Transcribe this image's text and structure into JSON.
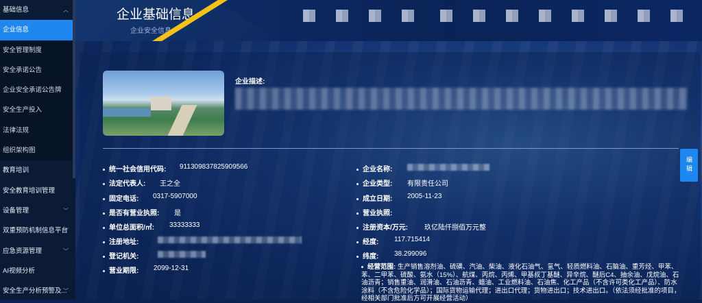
{
  "sidebar": {
    "items": [
      {
        "label": "基础信息",
        "type": "group",
        "chevron": "︿"
      },
      {
        "label": "企业信息",
        "type": "active"
      },
      {
        "label": "安全管理制度",
        "type": "sub"
      },
      {
        "label": "安全承诺公告",
        "type": "sub"
      },
      {
        "label": "企业安全承诺公告牌",
        "type": "sub"
      },
      {
        "label": "安全生产投入",
        "type": "sub"
      },
      {
        "label": "法律法规",
        "type": "sub"
      },
      {
        "label": "组织架构图",
        "type": "sub"
      },
      {
        "label": "教育培训",
        "type": "group"
      },
      {
        "label": "安全教育培训管理",
        "type": "group"
      },
      {
        "label": "设备管理",
        "type": "group",
        "chevron": "﹀"
      },
      {
        "label": "双重预防机制信息平台",
        "type": "group",
        "chevron": "﹀"
      },
      {
        "label": "应急资源管理",
        "type": "group",
        "chevron": "﹀"
      },
      {
        "label": "AI视频分析",
        "type": "group"
      },
      {
        "label": "安全生产分析预警及...",
        "type": "group",
        "chevron": "﹀"
      }
    ]
  },
  "header": {
    "title": "企业基础信息",
    "subtitle": "企业安全信息"
  },
  "company": {
    "desc_label": "企业描述:",
    "edit_label": "编辑",
    "left_fields": [
      {
        "label": "统一社会信用代码:",
        "value": "911309837825909566"
      },
      {
        "label": "法定代表人:",
        "value": "王之全"
      },
      {
        "label": "固定电话:",
        "value": "0317-5907000"
      },
      {
        "label": "是否有营业执照:",
        "value": "是"
      },
      {
        "label": "单位总面积/㎡:",
        "value": "33333333"
      },
      {
        "label": "注册地址:",
        "value": ""
      },
      {
        "label": "登记机关:",
        "value": ""
      },
      {
        "label": "营业期限:",
        "value": "2099-12-31"
      }
    ],
    "right_fields": [
      {
        "label": "企业名称:",
        "value": ""
      },
      {
        "label": "企业类型:",
        "value": "有限责任公司"
      },
      {
        "label": "成立日期:",
        "value": "2005-11-23"
      },
      {
        "label": "营业执照:",
        "value": ""
      },
      {
        "label": "注册资本/万元:",
        "value": "玖亿陆仟捌佰万元整"
      },
      {
        "label": "经度:",
        "value": "117.715414"
      },
      {
        "label": "纬度:",
        "value": "38.299096"
      }
    ],
    "scope_label": "经营范围:",
    "scope_text": "生产销售溶剂油、硫磺、汽油、柴油、液化石油气、氢气、轻质燃料油、石脑油、重芳烃、甲苯、苯、二甲苯、硫酸、氨水（15%）、航煤、丙烷、丙烯、甲基叔丁基醚、异辛烷、醚后C4、抽余油、戊烷油、石油沥青；销售重油、润滑油、石油沥青、蜡油、工业燃料油、石油焦、化工产品（不含许可类化工产品）、防水涂料（不含危险化学品）；国际货物运输代理；进出口代理；货物进出口；技术进出口。（依法须经批准的项目，经相关部门批准后方可开展经营活动）"
  },
  "colors": {
    "accent": "#1e88f0",
    "stripe": "#f2c21a",
    "sidebar_bg": "#0b1a35"
  }
}
